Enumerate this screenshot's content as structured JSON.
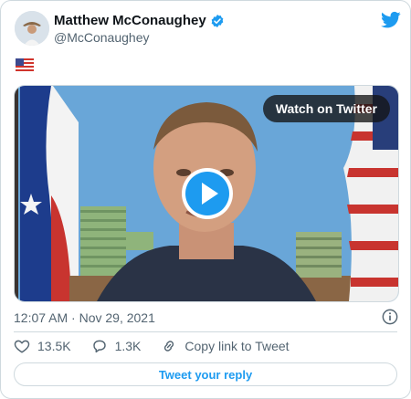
{
  "author": {
    "name": "Matthew McConaughey",
    "handle": "@McConaughey"
  },
  "tweet": {
    "text_emoji": "us-flag-emoji",
    "timestamp": "12:07 AM · Nov 29, 2021"
  },
  "media": {
    "watch_label": "Watch on Twitter"
  },
  "actions": {
    "likes": "13.5K",
    "replies": "1.3K",
    "copy_link": "Copy link to Tweet"
  },
  "reply": {
    "label": "Tweet your reply"
  },
  "colors": {
    "accent": "#1d9bf0",
    "muted": "#536471",
    "border": "#cfd9de"
  }
}
